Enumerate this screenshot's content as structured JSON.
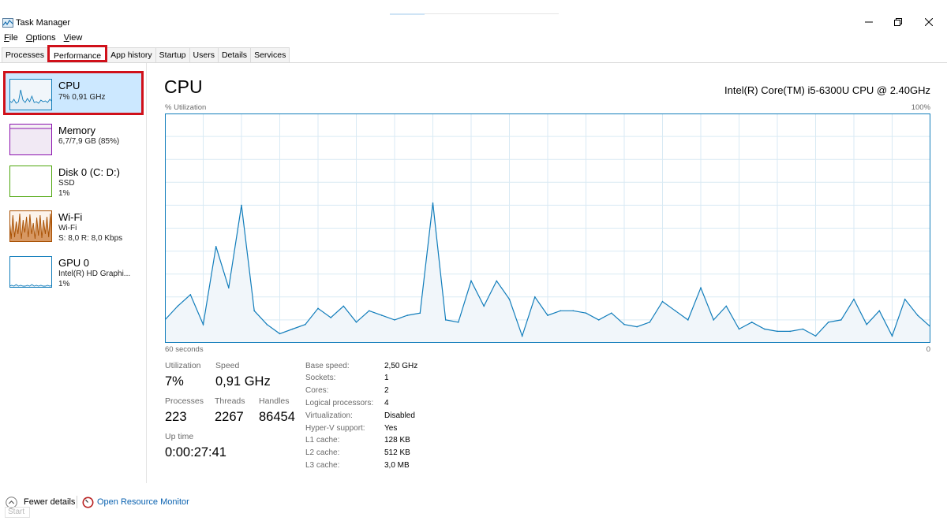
{
  "window": {
    "title": "Task Manager"
  },
  "menu": [
    {
      "label": "File",
      "underline": "F",
      "rest": "ile"
    },
    {
      "label": "Options",
      "underline": "O",
      "rest": "ptions"
    },
    {
      "label": "View",
      "underline": "V",
      "rest": "iew"
    }
  ],
  "tabs": [
    "Processes",
    "Performance",
    "App history",
    "Startup",
    "Users",
    "Details",
    "Services"
  ],
  "active_tab": "Performance",
  "sidebar": {
    "items": [
      {
        "name": "CPU",
        "lines": [
          "7% 0,91 GHz"
        ],
        "color": "#117dbb",
        "fill": "#f1f6fa"
      },
      {
        "name": "Memory",
        "lines": [
          "6,7/7,9 GB (85%)"
        ],
        "color": "#8b12ae",
        "fill": "#f4f2f4"
      },
      {
        "name": "Disk 0 (C: D:)",
        "lines": [
          "SSD",
          "1%"
        ],
        "color": "#4da60c",
        "fill": "#ffffff"
      },
      {
        "name": "Wi-Fi",
        "lines": [
          "Wi-Fi",
          "S: 8,0 R: 8,0 Kbps"
        ],
        "color": "#a74f01",
        "fill": "#fcf3eb"
      },
      {
        "name": "GPU 0",
        "lines": [
          "Intel(R) HD Graphi...",
          "1%"
        ],
        "color": "#117dbb",
        "fill": "#ffffff"
      }
    ]
  },
  "main": {
    "title": "CPU",
    "model": "Intel(R) Core(TM) i5-6300U CPU @ 2.40GHz",
    "y_label": "% Utilization",
    "y_max": "100%",
    "x_left": "60 seconds",
    "x_right": "0"
  },
  "chart_data": {
    "type": "area",
    "ylim": [
      0,
      100
    ],
    "x": [
      0,
      1,
      2,
      3,
      4,
      5,
      6,
      7,
      8,
      9,
      10,
      11,
      12,
      13,
      14,
      15,
      16,
      17,
      18,
      19,
      20,
      21,
      22,
      23,
      24,
      25,
      26,
      27,
      28,
      29,
      30,
      31,
      32,
      33,
      34,
      35,
      36,
      37,
      38,
      39,
      40,
      41,
      42,
      43,
      44,
      45,
      46,
      47,
      48,
      49,
      50,
      51,
      52,
      53,
      54,
      55,
      56,
      57,
      58,
      59,
      60
    ],
    "values": [
      10,
      16,
      21,
      8,
      42,
      24,
      60,
      14,
      8,
      4,
      6,
      8,
      15,
      11,
      16,
      9,
      14,
      12,
      10,
      12,
      13,
      61,
      10,
      9,
      27,
      16,
      27,
      19,
      3,
      20,
      12,
      14,
      14,
      13,
      10,
      13,
      8,
      7,
      9,
      18,
      14,
      10,
      24,
      10,
      16,
      6,
      9,
      6,
      5,
      5,
      6,
      3,
      9,
      10,
      19,
      8,
      14,
      3,
      19,
      12,
      7
    ],
    "color": "#117dbb",
    "fill": "#f1f6fa",
    "grid": true
  },
  "stats": {
    "utilization": {
      "label": "Utilization",
      "value": "7%"
    },
    "speed": {
      "label": "Speed",
      "value": "0,91 GHz"
    },
    "processes": {
      "label": "Processes",
      "value": "223"
    },
    "threads": {
      "label": "Threads",
      "value": "2267"
    },
    "handles": {
      "label": "Handles",
      "value": "86454"
    },
    "uptime": {
      "label": "Up time",
      "value": "0:00:27:41"
    }
  },
  "specs": [
    {
      "label": "Base speed:",
      "value": "2,50 GHz"
    },
    {
      "label": "Sockets:",
      "value": "1"
    },
    {
      "label": "Cores:",
      "value": "2"
    },
    {
      "label": "Logical processors:",
      "value": "4"
    },
    {
      "label": "Virtualization:",
      "value": "Disabled"
    },
    {
      "label": "Hyper-V support:",
      "value": "Yes"
    },
    {
      "label": "L1 cache:",
      "value": "128 KB"
    },
    {
      "label": "L2 cache:",
      "value": "512 KB"
    },
    {
      "label": "L3 cache:",
      "value": "3,0 MB"
    }
  ],
  "footer": {
    "fewer_details": "Fewer details",
    "fewer_underline": "d",
    "open_monitor": "Open Resource Monitor",
    "start": "Start"
  }
}
